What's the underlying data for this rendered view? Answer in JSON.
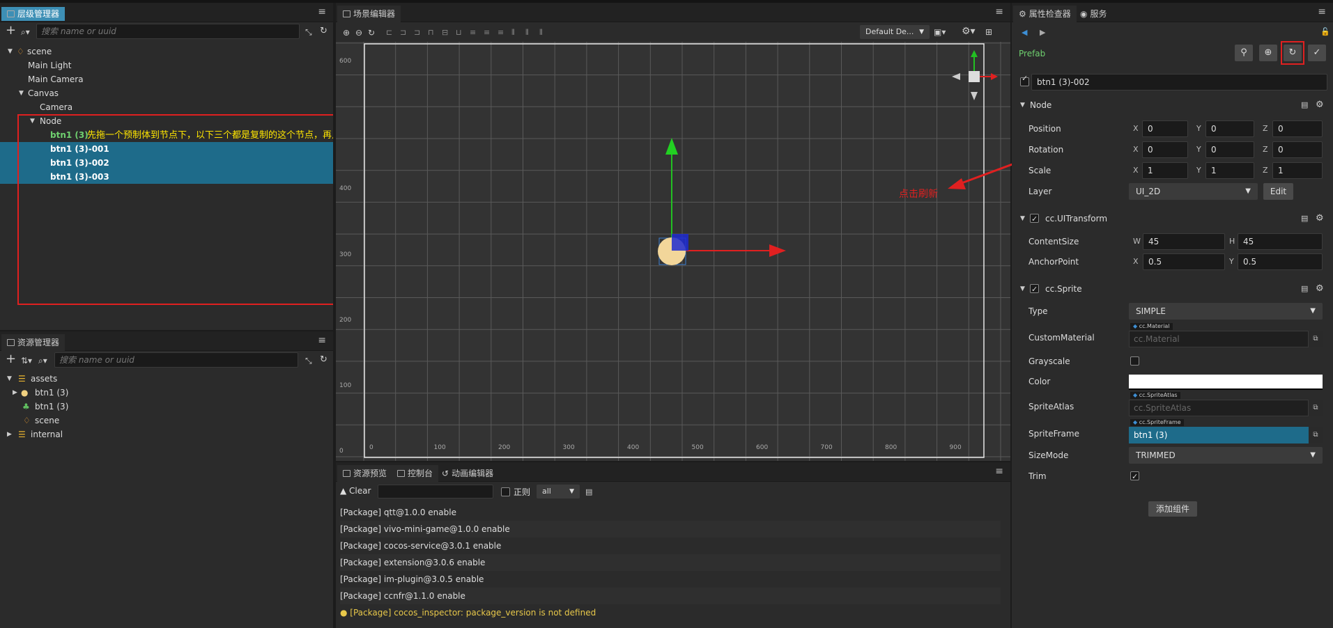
{
  "hierarchy": {
    "tab": "层级管理器",
    "search_placeholder": "搜索 name or uuid",
    "nodes": [
      {
        "label": "scene"
      },
      {
        "label": "Main Light"
      },
      {
        "label": "Main Camera"
      },
      {
        "label": "Canvas"
      },
      {
        "label": "Camera"
      },
      {
        "label": "Node"
      },
      {
        "label": "btn1 (3)"
      },
      {
        "label": "btn1 (3)-001"
      },
      {
        "label": "btn1 (3)-002"
      },
      {
        "label": "btn1 (3)-003"
      }
    ],
    "annotation": "先拖一个预制体到节点下，以下三个都是复制的这个节点，再点击右侧的刷新，就会出现复制的节点连在一起，且无法删除"
  },
  "assets": {
    "tab": "资源管理器",
    "search_placeholder": "搜索 name or uuid",
    "items": [
      {
        "label": "assets"
      },
      {
        "label": "btn1 (3)"
      },
      {
        "label": "btn1 (3)"
      },
      {
        "label": "scene"
      },
      {
        "label": "internal"
      }
    ]
  },
  "scene": {
    "tab": "场景编辑器",
    "layout_select": "Default De...",
    "y_ticks": [
      "600",
      "400",
      "300",
      "200",
      "100",
      "0"
    ],
    "x_ticks": [
      "0",
      "100",
      "200",
      "300",
      "400",
      "500",
      "600",
      "700",
      "800",
      "900"
    ]
  },
  "console": {
    "tabs": [
      "资源预览",
      "控制台",
      "动画编辑器"
    ],
    "clear_label": "Clear",
    "regex_label": "正则",
    "filter_value": "all",
    "lines": [
      {
        "text": "[Package] qtt@1.0.0 enable",
        "warn": false
      },
      {
        "text": "[Package] vivo-mini-game@1.0.0 enable",
        "warn": false
      },
      {
        "text": "[Package] cocos-service@3.0.1 enable",
        "warn": false
      },
      {
        "text": "[Package] extension@3.0.6 enable",
        "warn": false
      },
      {
        "text": "[Package] im-plugin@3.0.5 enable",
        "warn": false
      },
      {
        "text": "[Package] ccnfr@1.1.0 enable",
        "warn": false
      },
      {
        "text": "[Package] cocos_inspector: package_version is not defined",
        "warn": true
      }
    ]
  },
  "inspector": {
    "tabs": [
      "属性检查器",
      "服务"
    ],
    "prefab_label": "Prefab",
    "node_name": "btn1 (3)-002",
    "refresh_annotation": "点击刷新",
    "node_section": "Node",
    "position": {
      "label": "Position",
      "x": "0",
      "y": "0",
      "z": "0"
    },
    "rotation": {
      "label": "Rotation",
      "x": "0",
      "y": "0",
      "z": "0"
    },
    "scale": {
      "label": "Scale",
      "x": "1",
      "y": "1",
      "z": "1"
    },
    "layer": {
      "label": "Layer",
      "value": "UI_2D",
      "edit": "Edit"
    },
    "uitransform": {
      "title": "cc.UITransform",
      "content_size": {
        "label": "ContentSize",
        "w": "45",
        "h": "45"
      },
      "anchor_point": {
        "label": "AnchorPoint",
        "x": "0.5",
        "y": "0.5"
      }
    },
    "sprite": {
      "title": "cc.Sprite",
      "type": {
        "label": "Type",
        "value": "SIMPLE"
      },
      "custom_material": {
        "label": "CustomMaterial",
        "tag": "cc.Material",
        "value": "cc.Material"
      },
      "grayscale": {
        "label": "Grayscale"
      },
      "color": {
        "label": "Color",
        "value": "#ffffff"
      },
      "sprite_atlas": {
        "label": "SpriteAtlas",
        "tag": "cc.SpriteAtlas",
        "value": "cc.SpriteAtlas"
      },
      "sprite_frame": {
        "label": "SpriteFrame",
        "tag": "cc.SpriteFrame",
        "value": "btn1 (3)"
      },
      "size_mode": {
        "label": "SizeMode",
        "value": "TRIMMED"
      },
      "trim": {
        "label": "Trim"
      }
    },
    "add_component": "添加组件"
  },
  "colors": {
    "accent": "#3d8fb5",
    "selection": "#1e6b8a",
    "annotation_red": "#e02020",
    "annotation_yellow": "#ffe600",
    "warn": "#e8c84a"
  }
}
